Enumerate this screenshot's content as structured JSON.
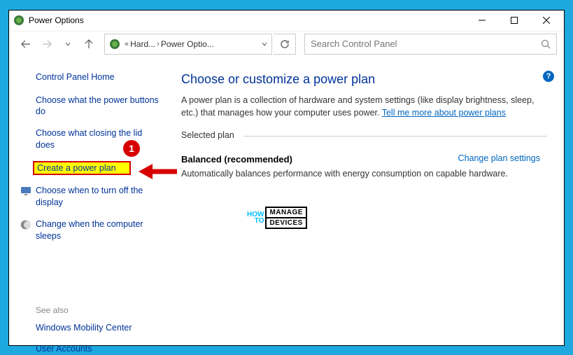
{
  "titlebar": {
    "title": "Power Options"
  },
  "breadcrumb": {
    "part1": "Hard...",
    "part2": "Power Optio...",
    "sep": "«"
  },
  "search": {
    "placeholder": "Search Control Panel"
  },
  "sidebar": {
    "home": "Control Panel Home",
    "link1": "Choose what the power buttons do",
    "link2": "Choose what closing the lid does",
    "link3": "Create a power plan",
    "link4": "Choose when to turn off the display",
    "link5": "Change when the computer sleeps",
    "see_also": "See also",
    "link6": "Windows Mobility Center",
    "link7": "User Accounts"
  },
  "main": {
    "title": "Choose or customize a power plan",
    "desc": "A power plan is a collection of hardware and system settings (like display brightness, sleep, etc.) that manages how your computer uses power. ",
    "tell_more": "Tell me more about power plans",
    "selected_label": "Selected plan",
    "plan_name": "Balanced (recommended)",
    "plan_change": "Change plan settings",
    "plan_desc": "Automatically balances performance with energy consumption on capable hardware."
  },
  "annotation": {
    "badge": "1"
  },
  "watermark": {
    "line1": "HOW",
    "line2": "TO",
    "box1": "MANAGE",
    "box2": "DEVICES"
  }
}
